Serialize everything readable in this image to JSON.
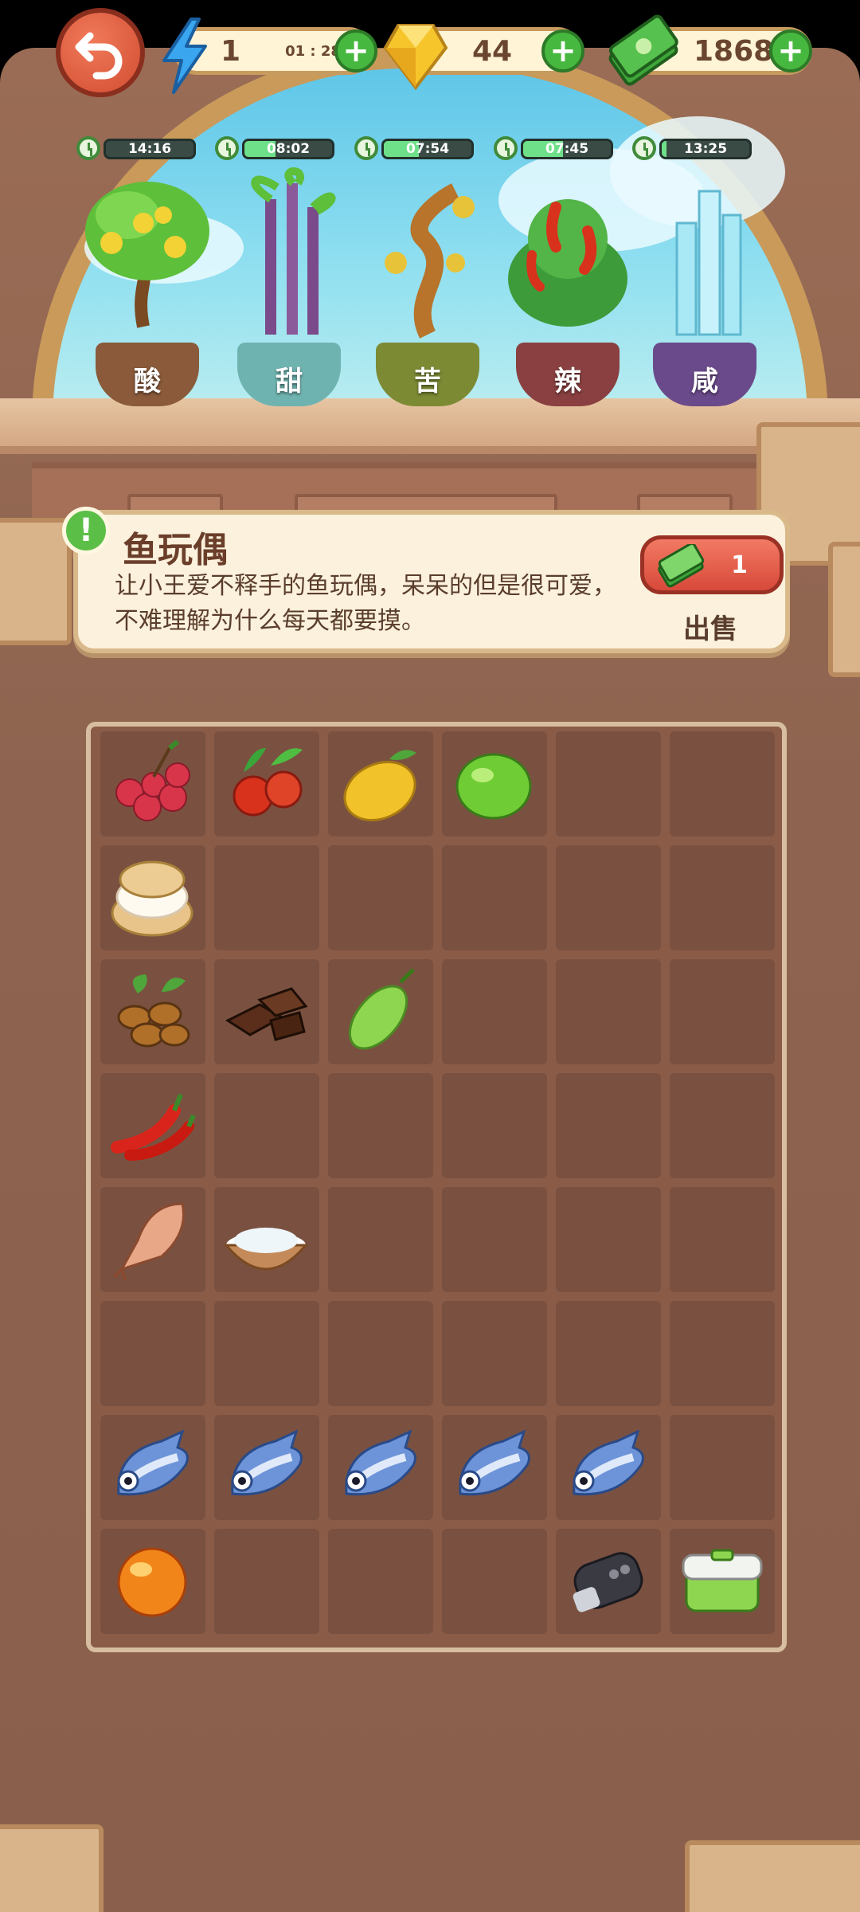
{
  "top_bar": {
    "energy": {
      "value": "1",
      "timer": "01 : 28"
    },
    "gems": {
      "value": "44"
    },
    "cash": {
      "value": "1868"
    }
  },
  "plants": [
    {
      "timer": "14:16",
      "label": "酸",
      "progress": 0.0
    },
    {
      "timer": "08:02",
      "label": "甜",
      "progress": 0.35
    },
    {
      "timer": "07:54",
      "label": "苦",
      "progress": 0.4
    },
    {
      "timer": "07:45",
      "label": "辣",
      "progress": 0.45
    },
    {
      "timer": "13:25",
      "label": "咸",
      "progress": 0.05
    }
  ],
  "info": {
    "title": "鱼玩偶",
    "description": "让小王爱不释手的鱼玩偶，呆呆的但是很可爱，不难理解为什么每天都要摸。",
    "sell_price": "1",
    "sell_label": "出售"
  },
  "grid": {
    "rows": [
      [
        "lychee-icon",
        "hawthorn-icon",
        "lemon-icon",
        "lime-icon",
        "",
        ""
      ],
      [
        "cream-puff-icon",
        "",
        "",
        "",
        "",
        ""
      ],
      [
        "coffee-bean-icon",
        "chocolate-icon",
        "bitter-melon-icon",
        "",
        "",
        ""
      ],
      [
        "chili-pepper-icon",
        "",
        "",
        "",
        "",
        ""
      ],
      [
        "dried-fish-icon",
        "salt-bowl-icon",
        "",
        "",
        "",
        ""
      ],
      [
        "",
        "",
        "",
        "",
        "",
        ""
      ],
      [
        "fish-toy-icon",
        "fish-toy-icon",
        "fish-toy-icon",
        "fish-toy-icon",
        "fish-toy-icon",
        ""
      ],
      [
        "orange-orb-icon",
        "",
        "",
        "",
        "car-key-icon",
        "lunch-box-icon"
      ]
    ]
  }
}
